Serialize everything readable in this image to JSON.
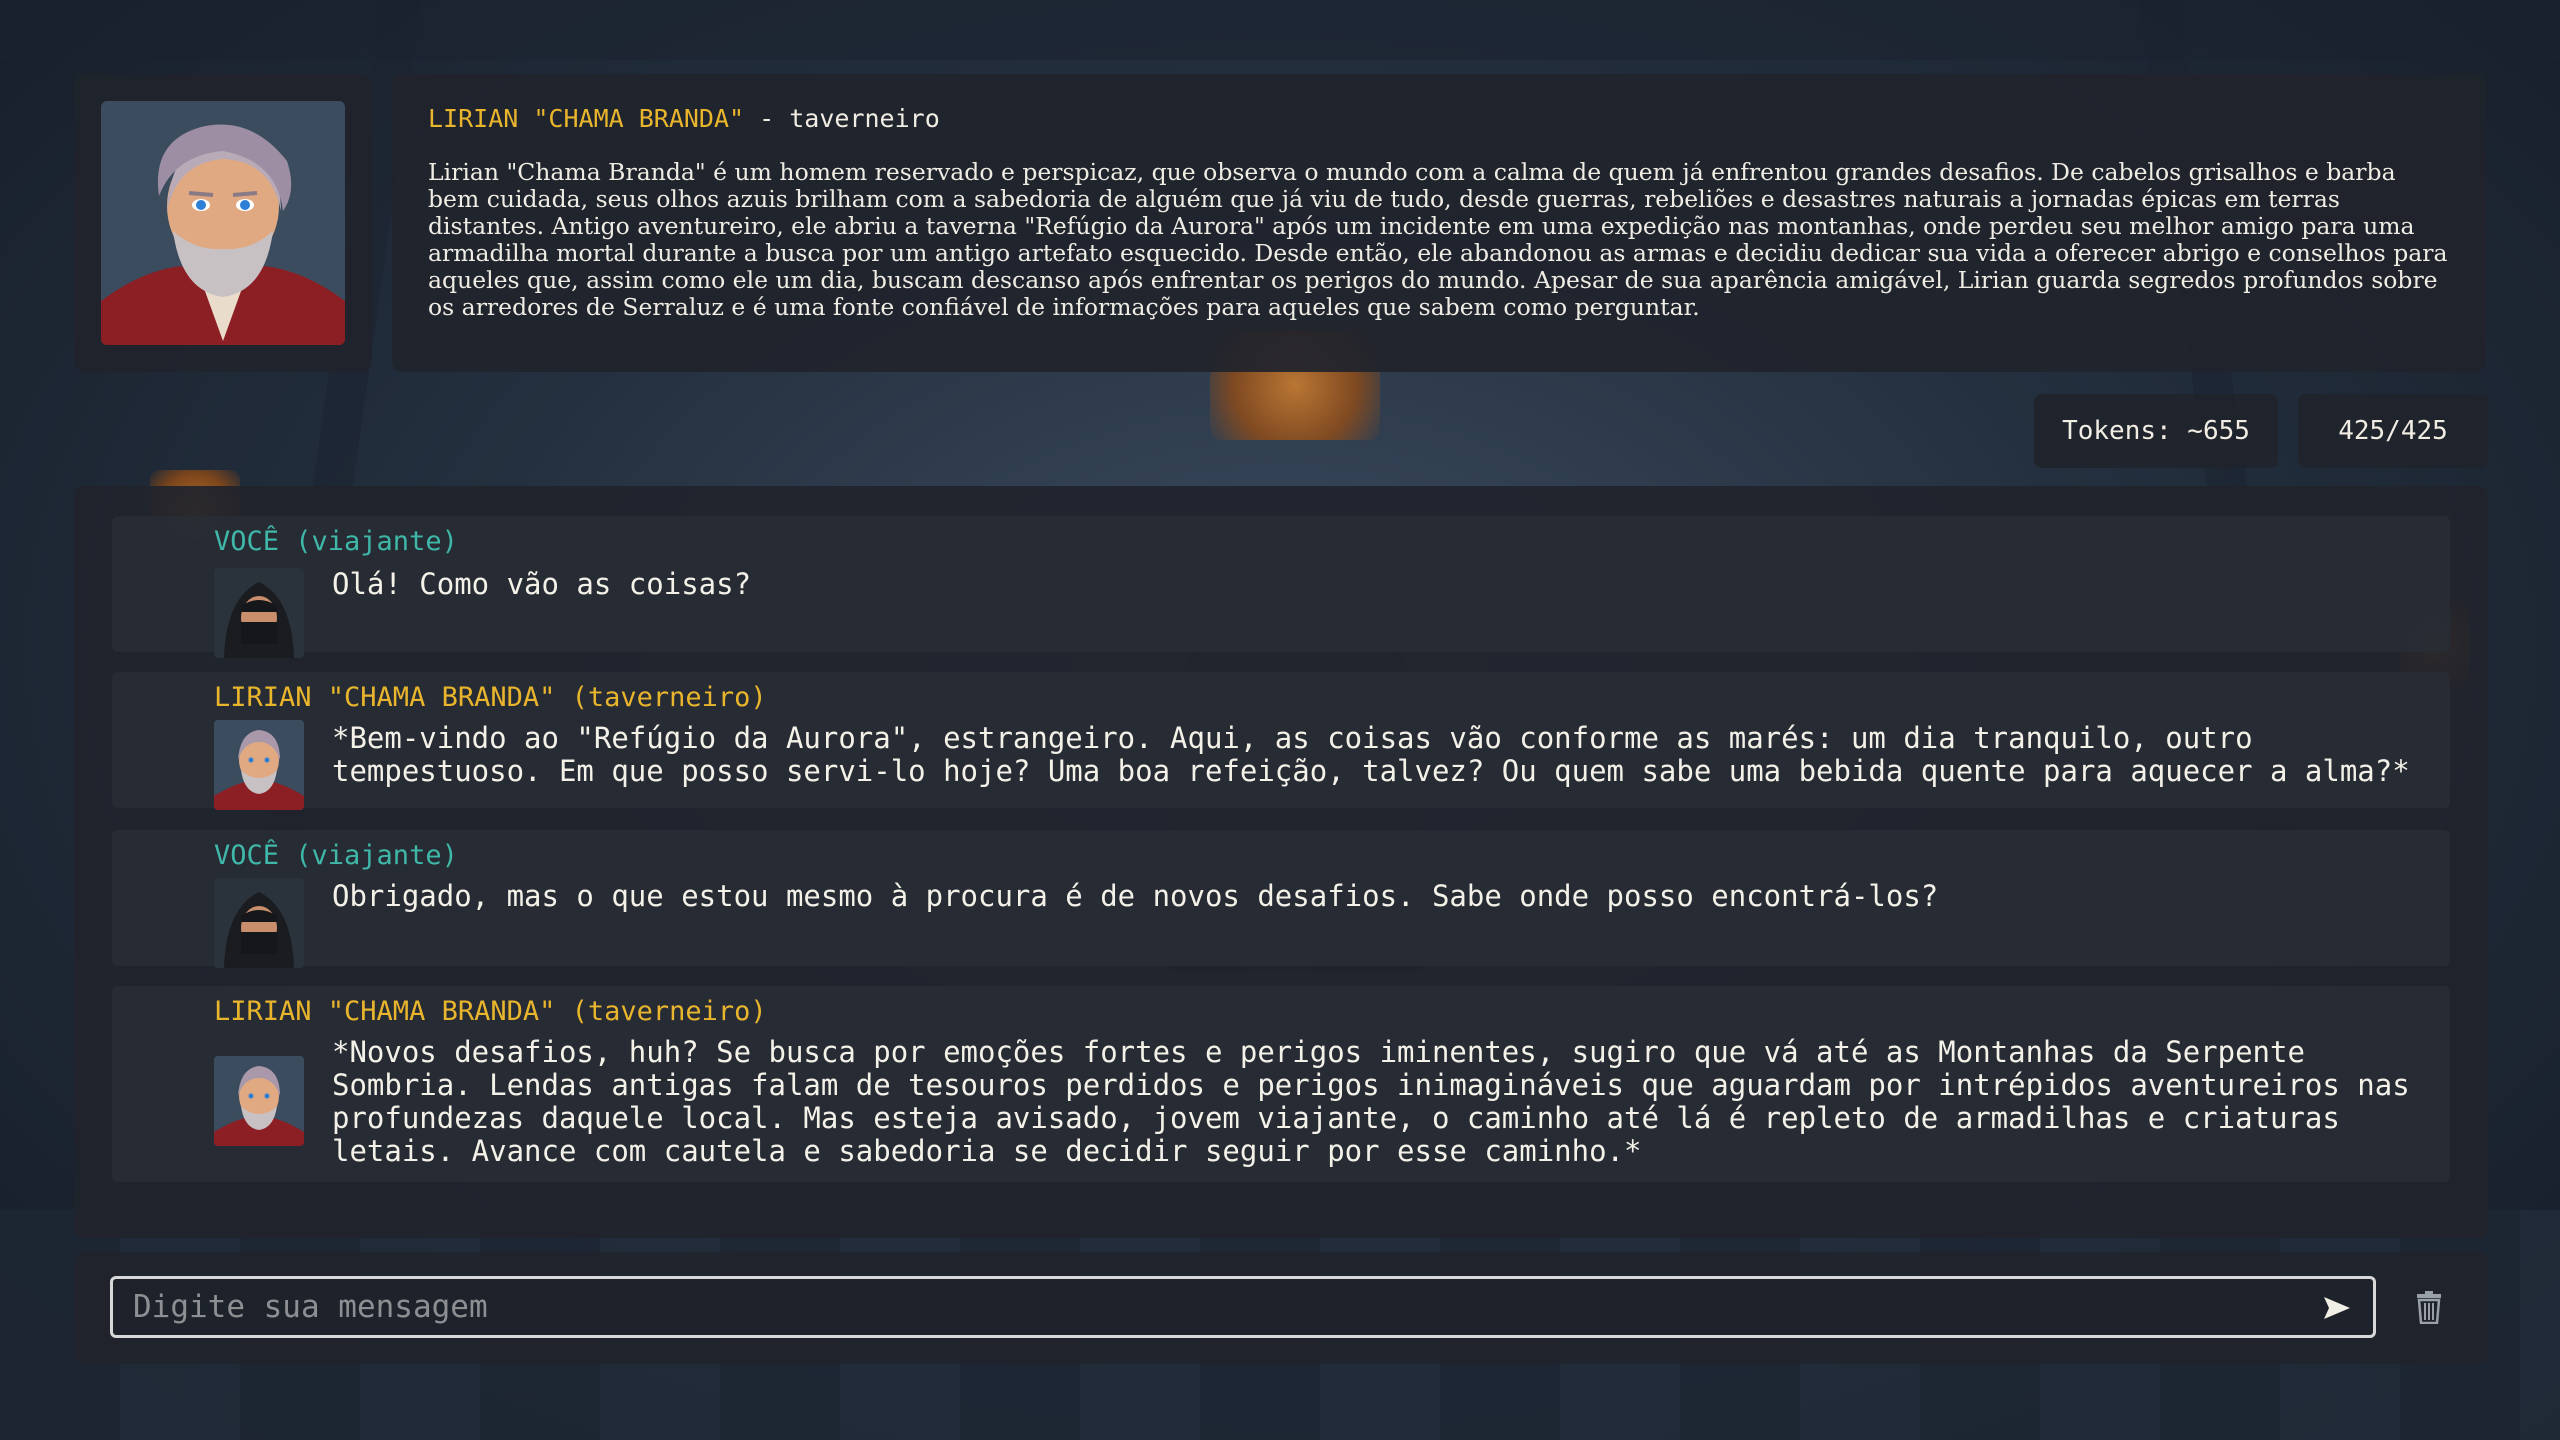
{
  "npc": {
    "name": "LIRIAN \"CHAMA BRANDA\"",
    "dash": " - ",
    "role": "taverneiro",
    "bio": "Lirian \"Chama Branda\" é um homem reservado e perspicaz, que observa o mundo com a calma de quem já enfrentou grandes desafios. De cabelos grisalhos e barba bem cuidada, seus olhos azuis brilham com a sabedoria de alguém que já viu de tudo, desde guerras, rebeliões e desastres naturais a jornadas épicas em terras distantes. Antigo aventureiro, ele abriu a taverna \"Refúgio da Aurora\" após um incidente em uma expedição nas montanhas, onde perdeu seu melhor amigo para uma armadilha mortal durante a busca por um antigo artefato esquecido. Desde então, ele abandonou as armas e decidiu dedicar sua vida a oferecer abrigo e conselhos para aqueles que, assim como ele um dia, buscam descanso após enfrentar os perigos do mundo. Apesar de sua aparência amigável, Lirian guarda segredos profundos sobre os arredores de Serraluz e é uma fonte confiável de informações para aqueles que sabem como perguntar."
  },
  "stats": {
    "tokens": "Tokens: ~655",
    "length": "425/425"
  },
  "messages": [
    {
      "role": "user",
      "author": "VOCÊ (viajante)",
      "text": "Olá! Como vão as coisas?"
    },
    {
      "role": "npc",
      "author": "LIRIAN \"CHAMA BRANDA\" (taverneiro)",
      "text": "*Bem-vindo ao \"Refúgio da Aurora\", estrangeiro. Aqui, as coisas vão conforme as marés: um dia tranquilo, outro tempestuoso. Em que posso servi-lo hoje? Uma boa refeição, talvez? Ou quem sabe uma bebida quente para aquecer a alma?*"
    },
    {
      "role": "user",
      "author": "VOCÊ (viajante)",
      "text": "Obrigado, mas o que estou mesmo à procura é de novos desafios. Sabe onde posso encontrá-los?"
    },
    {
      "role": "npc",
      "author": "LIRIAN \"CHAMA BRANDA\" (taverneiro)",
      "text": "*Novos desafios, huh? Se busca por emoções fortes e perigos iminentes, sugiro que vá até as Montanhas da Serpente Sombria. Lendas antigas falam de tesouros perdidos e perigos inimagináveis que aguardam por intrépidos aventureiros nas profundezas daquele local. Mas esteja avisado, jovem viajante, o caminho até lá é repleto de armadilhas e criaturas letais. Avance com cautela e sabedoria se decidir seguir por esse caminho.*"
    }
  ],
  "composer": {
    "placeholder": "Digite sua mensagem",
    "value": "",
    "send_icon": "send-arrow-icon",
    "clear_icon": "trash-icon"
  },
  "colors": {
    "npc_name": "#e9b52c",
    "user_name": "#3fb8a9",
    "panel": "#20242c"
  }
}
